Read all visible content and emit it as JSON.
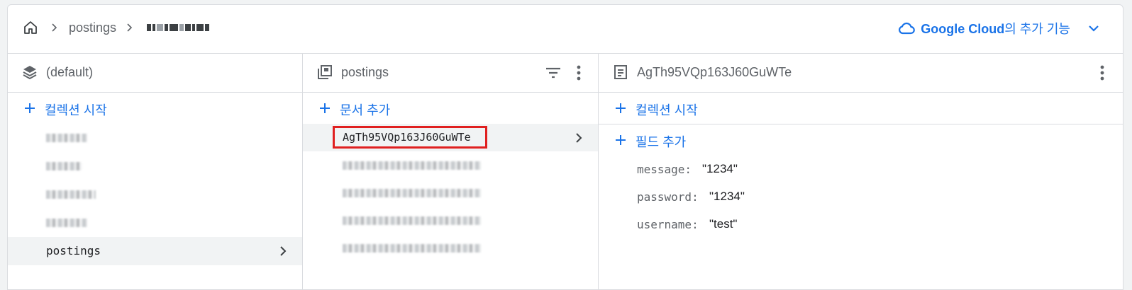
{
  "breadcrumb": {
    "home_icon": "home-icon",
    "items": [
      "postings"
    ],
    "redacted_item": true
  },
  "google_cloud": {
    "label_bold": "Google Cloud",
    "label_rest": "의 추가 기능",
    "icon": "cloud-icon",
    "accent": "#1a73e8"
  },
  "panel_root": {
    "title": "(default)",
    "icon": "database-icon",
    "add_label": "컬렉션 시작",
    "collections": [
      {
        "label": "",
        "redacted": true
      },
      {
        "label": "",
        "redacted": true
      },
      {
        "label": "",
        "redacted": true
      },
      {
        "label": "",
        "redacted": true
      },
      {
        "label": "postings",
        "redacted": false,
        "selected": true
      }
    ]
  },
  "panel_collection": {
    "title": "postings",
    "icon": "collection-icon",
    "add_label": "문서 추가",
    "documents": [
      {
        "id": "AgTh95VQp163J60GuWTe",
        "selected": true,
        "redacted": false
      },
      {
        "id": "",
        "redacted": true
      },
      {
        "id": "",
        "redacted": true
      },
      {
        "id": "",
        "redacted": true
      },
      {
        "id": "",
        "redacted": true
      }
    ]
  },
  "panel_document": {
    "title": "AgTh95VQp163J60GuWTe",
    "icon": "document-icon",
    "add_collection_label": "컬렉션 시작",
    "add_field_label": "필드 추가",
    "fields": [
      {
        "key": "message:",
        "value": "\"1234\""
      },
      {
        "key": "password:",
        "value": "\"1234\""
      },
      {
        "key": "username:",
        "value": "\"test\""
      }
    ]
  },
  "colors": {
    "accent": "#1a73e8",
    "highlight": "#e02020",
    "selected_bg": "#f1f3f4"
  }
}
